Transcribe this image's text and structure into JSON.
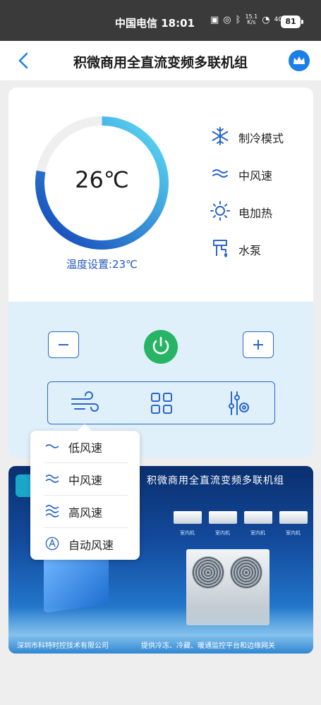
{
  "status_bar": {
    "carrier_time": "中国电信 18:01",
    "net_speed_top": "15.1",
    "net_speed_bottom": "K/s",
    "signal": "4G",
    "battery": "81"
  },
  "nav": {
    "title": "积微商用全直流变频多联机组",
    "back_icon": "chevron-left-icon",
    "vip_icon": "crown-icon"
  },
  "gauge": {
    "current_temp": "26℃",
    "setpoint_text": "温度设置:23℃",
    "fill_fraction": 0.78,
    "colors": {
      "track": "#efefef",
      "start": "#1040b8",
      "end": "#5fe0f5"
    }
  },
  "status_items": [
    {
      "icon": "snowflake-icon",
      "label": "制冷模式"
    },
    {
      "icon": "wind-icon",
      "label": "中风速"
    },
    {
      "icon": "sun-icon",
      "label": "电加热"
    },
    {
      "icon": "water-pump-icon",
      "label": "水泵"
    }
  ],
  "controls": {
    "minus_icon": "minus-icon",
    "plus_icon": "plus-icon",
    "power_icon": "power-icon",
    "power_color": "#27b465",
    "func_buttons": [
      "fan-speed-icon",
      "grid-menu-icon",
      "settings-sliders-icon"
    ]
  },
  "fan_popup": {
    "items": [
      {
        "icon": "wind-low-icon",
        "label": "低风速"
      },
      {
        "icon": "wind-mid-icon",
        "label": "中风速"
      },
      {
        "icon": "wind-high-icon",
        "label": "高风速"
      },
      {
        "icon": "auto-wind-icon",
        "label": "自动风速"
      }
    ]
  },
  "banner": {
    "title": "积微商用全直流变频多联机组",
    "indoor_label": "室内机",
    "footer_left": "深圳市科特时控技术有限公司",
    "footer_right": "提供冷冻、冷藏、暖通监控平台和边缘网关"
  },
  "colors": {
    "accent": "#2a66c8",
    "panel": "#dff0fb"
  }
}
